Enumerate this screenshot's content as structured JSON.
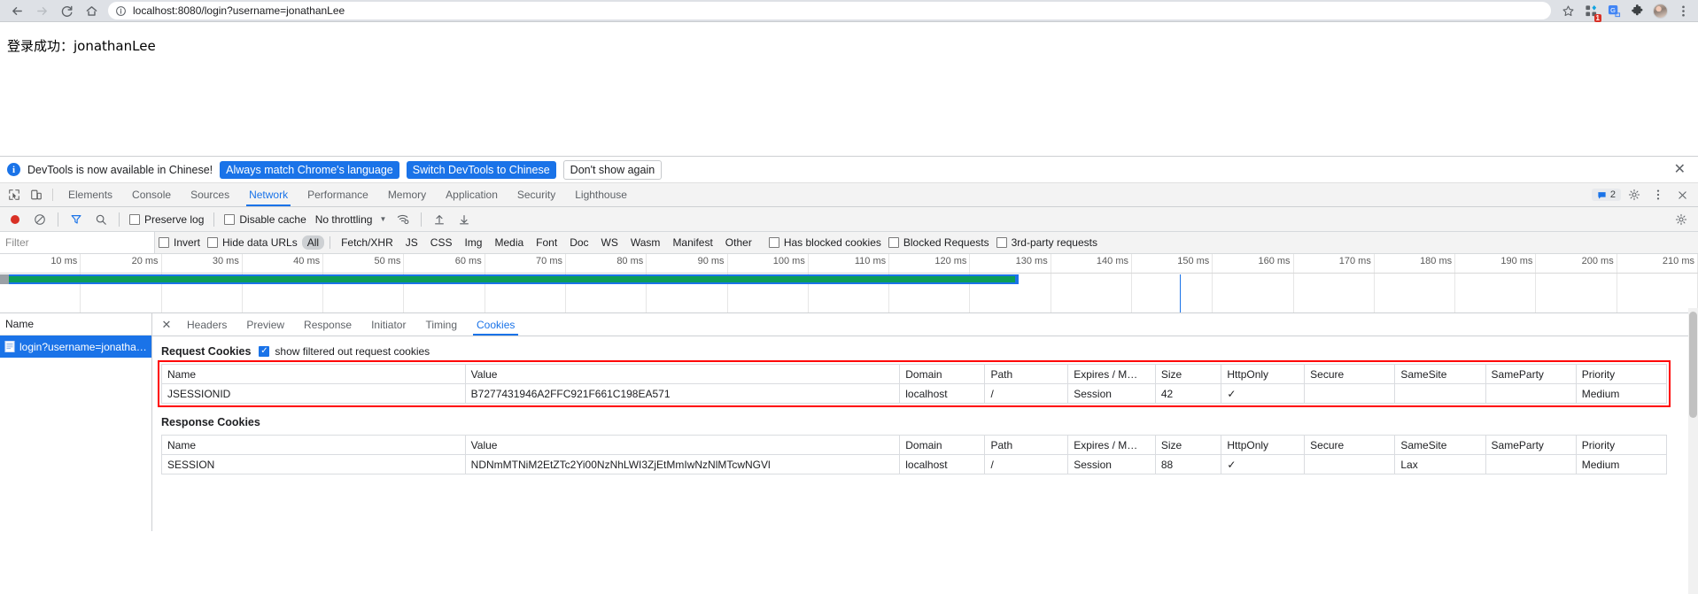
{
  "browser": {
    "back_icon": "back-arrow-icon",
    "forward_icon": "forward-arrow-icon",
    "reload_icon": "reload-icon",
    "home_icon": "home-icon",
    "site_info_icon": "site-info-icon",
    "url": "localhost:8080/login?username=jonathanLee",
    "url_host": "localhost:8080",
    "url_path": "/login?username=jonathanLee",
    "bookmark_icon": "star-icon",
    "apps_icon": "extension-apps-icon",
    "apps_badge": "1",
    "translate_icon": "translate-icon",
    "puzzle_icon": "puzzle-extensions-icon",
    "profile_icon": "profile-avatar-icon",
    "menu_icon": "three-dot-menu-icon"
  },
  "page": {
    "body_text": "登录成功：jonathanLee"
  },
  "devtools": {
    "banner": {
      "info_icon": "info-icon",
      "message": "DevTools is now available in Chinese!",
      "primary_btn": "Always match Chrome's language",
      "secondary_btn": "Switch DevTools to Chinese",
      "dismiss_btn": "Don't show again",
      "close_icon": "close-icon"
    },
    "tabs": [
      "Elements",
      "Console",
      "Sources",
      "Network",
      "Performance",
      "Memory",
      "Application",
      "Security",
      "Lighthouse"
    ],
    "active_tab": "Network",
    "inspect_icon": "inspect-element-icon",
    "device_icon": "device-toolbar-icon",
    "messages_icon": "message-icon",
    "messages_count": "2",
    "settings_icon": "gear-icon",
    "more_icon": "three-dot-menu-icon",
    "close_icon": "close-icon"
  },
  "network_toolbar": {
    "record_icon": "record-stop-icon",
    "clear_icon": "clear-icon",
    "filter_icon": "filter-funnel-icon",
    "search_icon": "search-icon",
    "preserve_log": {
      "label": "Preserve log",
      "checked": false
    },
    "disable_cache": {
      "label": "Disable cache",
      "checked": false
    },
    "throttling": {
      "value": "No throttling",
      "caret": "chevron-down-icon"
    },
    "wifi_icon": "network-conditions-icon",
    "import_icon": "import-har-icon",
    "export_icon": "export-har-icon",
    "settings_icon": "gear-icon"
  },
  "filter_bar": {
    "placeholder": "Filter",
    "value": "",
    "invert": {
      "label": "Invert",
      "checked": false
    },
    "hide_data_urls": {
      "label": "Hide data URLs",
      "checked": false
    },
    "types": [
      "All",
      "Fetch/XHR",
      "JS",
      "CSS",
      "Img",
      "Media",
      "Font",
      "Doc",
      "WS",
      "Wasm",
      "Manifest",
      "Other"
    ],
    "active_type": "All",
    "has_blocked_cookies": {
      "label": "Has blocked cookies",
      "checked": false
    },
    "blocked_requests": {
      "label": "Blocked Requests",
      "checked": false
    },
    "third_party": {
      "label": "3rd-party requests",
      "checked": false
    }
  },
  "overview": {
    "ticks": [
      "10 ms",
      "20 ms",
      "30 ms",
      "40 ms",
      "50 ms",
      "60 ms",
      "70 ms",
      "80 ms",
      "90 ms",
      "100 ms",
      "110 ms",
      "120 ms",
      "130 ms",
      "140 ms",
      "150 ms",
      "160 ms",
      "170 ms",
      "180 ms",
      "190 ms",
      "200 ms",
      "210 ms"
    ],
    "bar_color_blue": "#1a73e8",
    "bar_color_green": "#0b9d58",
    "bar_end_pct": 60.0,
    "marker_pct": 69.5
  },
  "requests": {
    "column_header": "Name",
    "rows": [
      {
        "icon": "document-icon",
        "name": "login?username=jonatha…",
        "selected": true
      }
    ]
  },
  "detail": {
    "close_icon": "close-icon",
    "tabs": [
      "Headers",
      "Preview",
      "Response",
      "Initiator",
      "Timing",
      "Cookies"
    ],
    "active_tab": "Cookies",
    "request_section": {
      "title": "Request Cookies",
      "filter_toggle": {
        "label": "show filtered out request cookies",
        "checked": true
      },
      "columns": [
        "Name",
        "Value",
        "Domain",
        "Path",
        "Expires / M…",
        "Size",
        "HttpOnly",
        "Secure",
        "SameSite",
        "SameParty",
        "Priority"
      ],
      "rows": [
        {
          "name": "JSESSIONID",
          "value": "B7277431946A2FFC921F661C198EA571",
          "domain": "localhost",
          "path": "/",
          "expires": "Session",
          "size": "42",
          "httponly": "✓",
          "secure": "",
          "samesite": "",
          "sameparty": "",
          "priority": "Medium"
        }
      ]
    },
    "response_section": {
      "title": "Response Cookies",
      "columns": [
        "Name",
        "Value",
        "Domain",
        "Path",
        "Expires / M…",
        "Size",
        "HttpOnly",
        "Secure",
        "SameSite",
        "SameParty",
        "Priority"
      ],
      "rows": [
        {
          "name": "SESSION",
          "value": "NDNmMTNiM2EtZTc2Yi00NzNhLWI3ZjEtMmIwNzNlMTcwNGVl",
          "domain": "localhost",
          "path": "/",
          "expires": "Session",
          "size": "88",
          "httponly": "✓",
          "secure": "",
          "samesite": "Lax",
          "sameparty": "",
          "priority": "Medium"
        }
      ]
    }
  },
  "annotation": {
    "highlight_color": "#ff0000"
  }
}
